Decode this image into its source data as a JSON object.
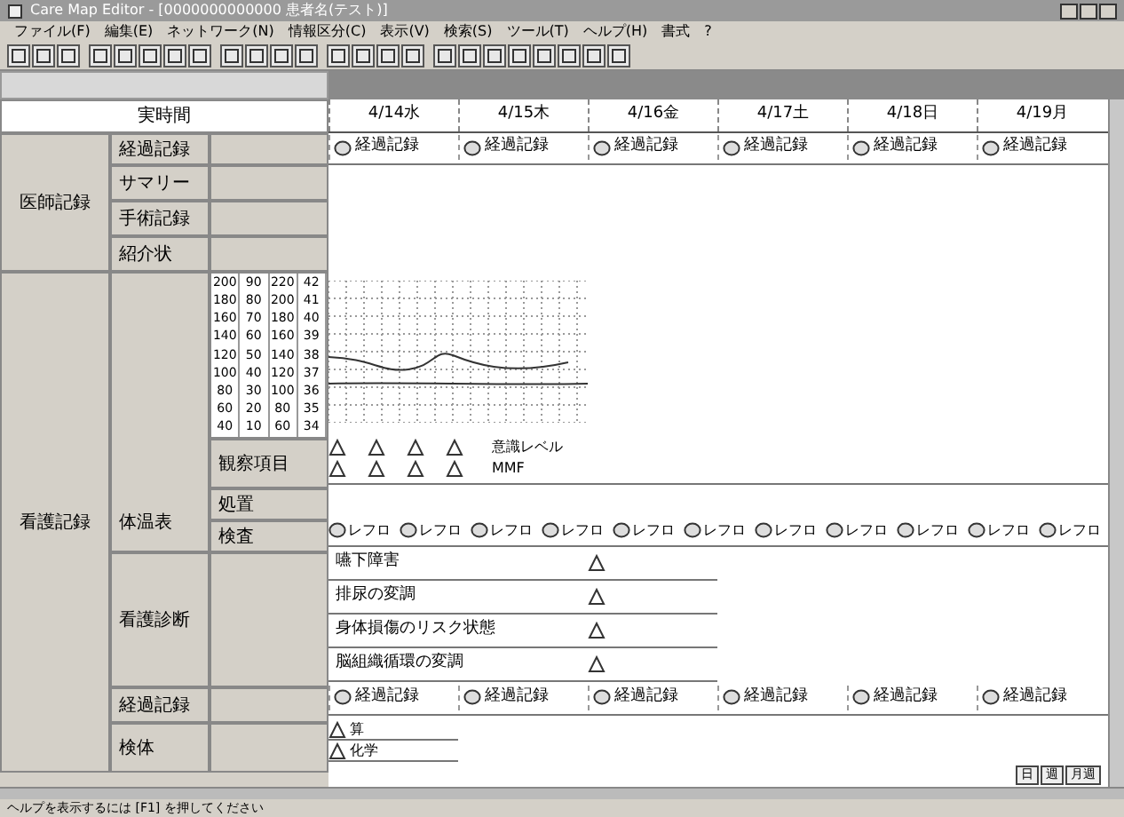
{
  "window": {
    "title": "Care Map Editor - [0000000000000 患者名(テスト)]",
    "menu": [
      "ファイル(F)",
      "編集(E)",
      "ネットワーク(N)",
      "情報区分(C)",
      "表示(V)",
      "検索(S)",
      "ツール(T)",
      "ヘルプ(H)",
      "書式",
      "?"
    ]
  },
  "header": {
    "label": "実時間",
    "dates": [
      "4/14水",
      "4/15木",
      "4/16金",
      "4/17土",
      "4/18日",
      "4/19月"
    ]
  },
  "doctor": {
    "label": "医師記録",
    "rows": [
      {
        "label": "経過記録",
        "events": [
          "経過記録",
          "経過記録",
          "経過記録",
          "経過記録",
          "経過記録",
          "経過記録"
        ]
      },
      {
        "label": "サマリー",
        "events": []
      },
      {
        "label": "手術記録",
        "events": []
      },
      {
        "label": "紹介状",
        "events": []
      }
    ]
  },
  "nursing": {
    "label": "看護記録",
    "vitals": {
      "label": "体温表",
      "scale": [
        [
          "200",
          "180",
          "160",
          "140",
          "120",
          "100",
          "80",
          "60",
          "40"
        ],
        [
          "90",
          "80",
          "70",
          "60",
          "50",
          "40",
          "30",
          "20",
          "10"
        ],
        [
          "220",
          "200",
          "180",
          "160",
          "140",
          "120",
          "100",
          "80",
          "60"
        ],
        [
          "42",
          "41",
          "40",
          "39",
          "38",
          "37",
          "36",
          "35",
          "34"
        ]
      ],
      "observation": {
        "label": "観察項目",
        "lines": [
          "意識レベル",
          "MMF"
        ]
      },
      "treatment": {
        "label": "処置"
      },
      "tests": {
        "label": "検査",
        "events": [
          "レフロ",
          "レフロ",
          "レフロ",
          "レフロ",
          "レフロ",
          "レフロ",
          "レフロ",
          "レフロ",
          "レフロ",
          "レフロ",
          "レフロ"
        ]
      }
    },
    "diagnosis": {
      "label": "看護診断",
      "items": [
        "嚥下障害",
        "排尿の変調",
        "身体損傷のリスク状態",
        "脳組織循環の変調"
      ]
    },
    "progress": {
      "label": "経過記録",
      "events": [
        "経過記録",
        "経過記録",
        "経過記録",
        "経過記録",
        "経過記録",
        "経過記録"
      ]
    },
    "specimen": {
      "label": "検体",
      "items": [
        "算",
        "化学"
      ]
    }
  },
  "view_buttons": [
    "日",
    "週",
    "月週"
  ],
  "status_bar": "ヘルプを表示するには [F1] を押してください"
}
